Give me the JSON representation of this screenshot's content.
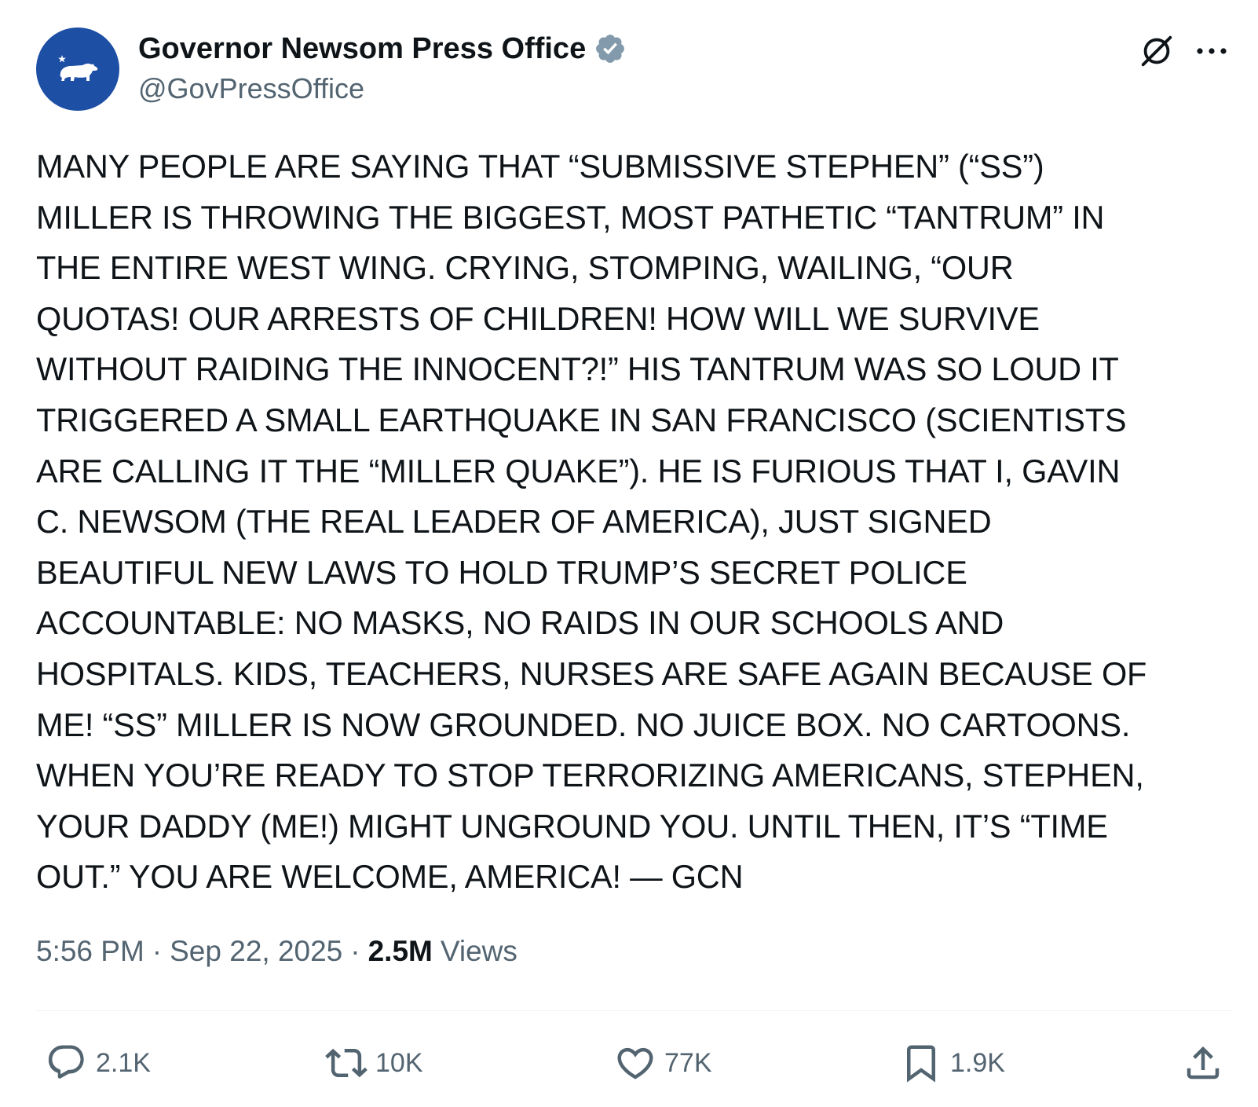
{
  "author": {
    "display_name": "Governor Newsom Press Office",
    "handle": "@GovPressOffice",
    "verified": true,
    "avatar_icon": "california-bear-icon",
    "avatar_color": "#1d4fa5"
  },
  "header_actions": {
    "grok_icon": "grok-icon",
    "more_icon": "more-options-icon"
  },
  "tweet": {
    "text": "MANY PEOPLE ARE SAYING THAT “SUBMISSIVE STEPHEN” (“SS”)\nMILLER IS THROWING THE BIGGEST, MOST PATHETIC “TANTRUM” IN\nTHE ENTIRE WEST WING. CRYING, STOMPING, WAILING, “OUR\nQUOTAS! OUR ARRESTS OF CHILDREN! HOW WILL WE SURVIVE\nWITHOUT RAIDING THE INNOCENT?!” HIS TANTRUM WAS SO LOUD IT\nTRIGGERED A SMALL EARTHQUAKE IN SAN FRANCISCO (SCIENTISTS\nARE CALLING IT THE “MILLER QUAKE”). HE IS FURIOUS THAT I, GAVIN\nC. NEWSOM (THE REAL LEADER OF AMERICA), JUST SIGNED\nBEAUTIFUL NEW LAWS TO HOLD TRUMP’S SECRET POLICE\nACCOUNTABLE: NO MASKS, NO RAIDS IN OUR SCHOOLS AND\nHOSPITALS. KIDS, TEACHERS, NURSES ARE SAFE AGAIN BECAUSE OF\nME! “SS” MILLER IS NOW GROUNDED. NO JUICE BOX. NO CARTOONS.\nWHEN YOU’RE READY TO STOP TERRORIZING AMERICANS, STEPHEN,\nYOUR DADDY (ME!) MIGHT UNGROUND YOU. UNTIL THEN, IT’S “TIME\nOUT.” YOU ARE WELCOME, AMERICA! — GCN",
    "time": "5:56 PM",
    "separator": "·",
    "date": "Sep 22, 2025",
    "views_count": "2.5M",
    "views_label": "Views"
  },
  "actions": {
    "reply": {
      "icon": "reply-icon",
      "count": "2.1K"
    },
    "repost": {
      "icon": "repost-icon",
      "count": "10K"
    },
    "like": {
      "icon": "heart-icon",
      "count": "77K"
    },
    "bookmark": {
      "icon": "bookmark-icon",
      "count": "1.9K"
    },
    "share": {
      "icon": "share-icon"
    }
  },
  "colors": {
    "text_primary": "#0f1419",
    "text_secondary": "#536471",
    "verified_badge": "#829aab",
    "divider": "#eff3f4"
  }
}
